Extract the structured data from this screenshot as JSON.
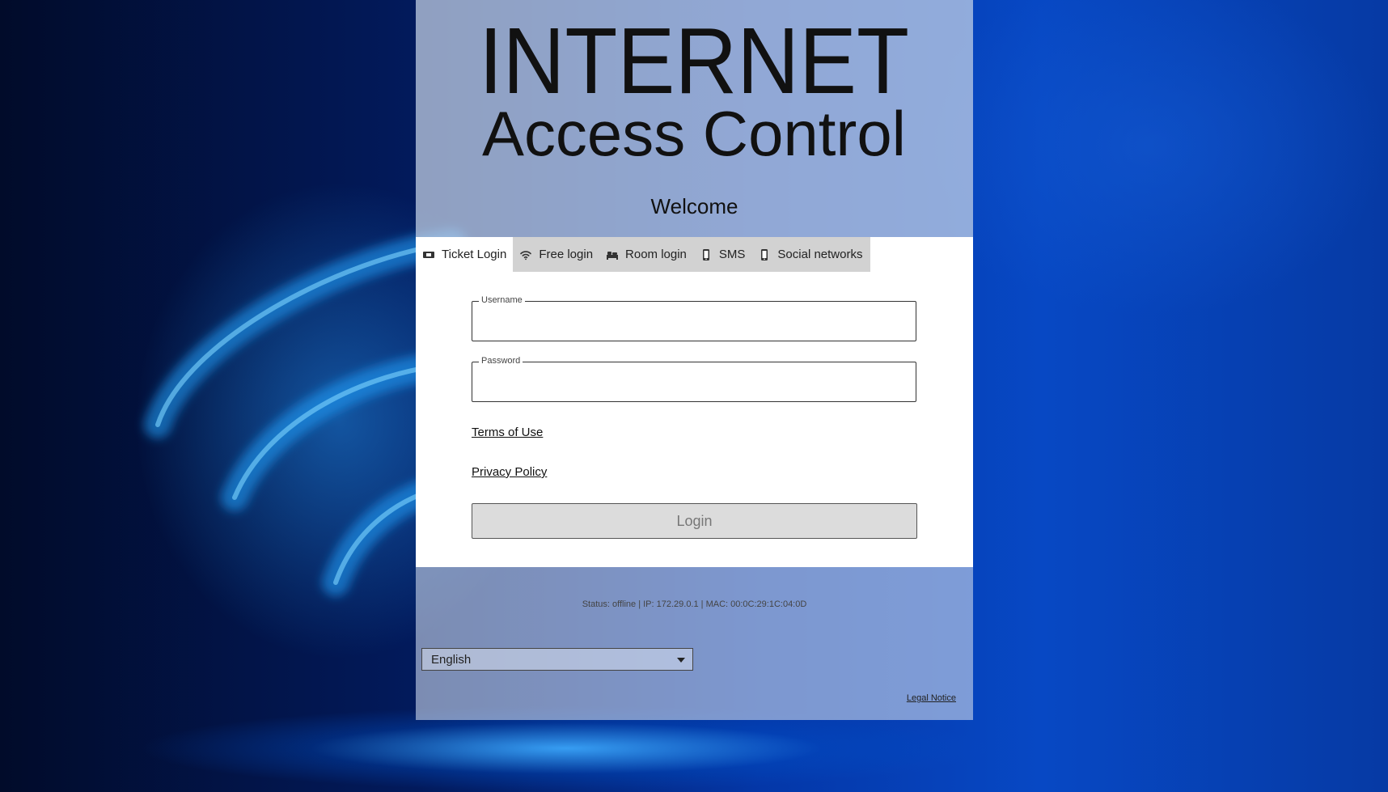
{
  "header": {
    "logo_line1": "INTERNET",
    "logo_line2": "Access Control",
    "welcome": "Welcome"
  },
  "tabs": [
    {
      "label": "Ticket Login",
      "icon": "ticket-icon",
      "active": true
    },
    {
      "label": "Free login",
      "icon": "wifi-icon",
      "active": false
    },
    {
      "label": "Room login",
      "icon": "bed-icon",
      "active": false
    },
    {
      "label": "SMS",
      "icon": "phone-icon",
      "active": false
    },
    {
      "label": "Social networks",
      "icon": "phone-icon",
      "active": false
    }
  ],
  "form": {
    "username_label": "Username",
    "username_value": "",
    "password_label": "Password",
    "password_value": "",
    "terms_link": "Terms of Use",
    "privacy_link": "Privacy Policy",
    "login_button": "Login"
  },
  "footer": {
    "status": "Status: offline | IP: 172.29.0.1 | MAC: 00:0C:29:1C:04:0D",
    "language_selected": "English",
    "legal_notice": "Legal Notice"
  },
  "colors": {
    "header_bg": "#c8d4e8",
    "card_bg": "#ffffff",
    "tab_inactive_bg": "#d2d2d2",
    "background_blue": "#0748c4"
  }
}
